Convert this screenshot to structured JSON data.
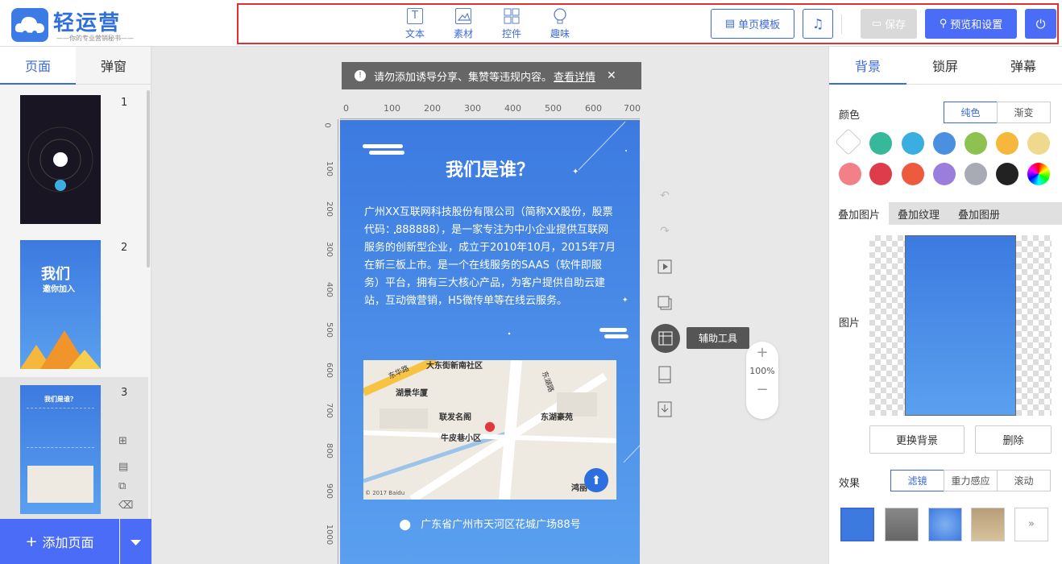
{
  "app": {
    "name": "轻运营",
    "tagline": "——你的专业营销秘书——"
  },
  "toolbar": {
    "tools": [
      "文本",
      "素材",
      "控件",
      "趣味"
    ],
    "single_page_template": "单页模板",
    "save": "保存",
    "preview_settings": "预览和设置"
  },
  "left": {
    "tabs": [
      "页面",
      "弹窗"
    ],
    "pages": [
      "1",
      "2",
      "3"
    ],
    "thumb2_title": "我们",
    "thumb2_sub": "邀你加入",
    "thumb3_title": "我们是谁？",
    "add_page": "添加页面"
  },
  "canvas": {
    "notice": "请勿添加诱导分享、集赞等违规内容。",
    "notice_link": "查看详情",
    "ruler_top": [
      "0",
      "100",
      "200",
      "300",
      "400",
      "500",
      "600",
      "700"
    ],
    "ruler_left": [
      "0",
      "100",
      "200",
      "300",
      "400",
      "500",
      "600",
      "700",
      "800",
      "900",
      "1000"
    ],
    "heading": "我们是谁？",
    "body": "广州XX互联网科技股份有限公司（简称XX股份，股票代码：888888），是一家专注为中小企业提供互联网服务的创新型企业，成立于2010年10月，2015年7月在新三板上市。是一个在线服务的SAAS（软件即服务）平台，拥有三大核心产品，为客户提供自助云建站，互动微营销，H5微传单等在线云服务。",
    "address": "广东省广州市天河区花城广场88号",
    "map_labels": [
      "大东街新南社区",
      "东华路",
      "湖景华厦",
      "联发名阁",
      "东湖豪苑",
      "牛皮巷小区",
      "东湖路",
      "鸿丽",
      "© 2017 Baidu"
    ]
  },
  "side_tools": {
    "assist_tip": "辅助工具",
    "zoom": "100%"
  },
  "right": {
    "tabs": [
      "背景",
      "锁屏",
      "弹幕"
    ],
    "color_label": "颜色",
    "color_modes": [
      "纯色",
      "渐变"
    ],
    "swatches": [
      "#ffffff",
      "#36b89a",
      "#3aaee0",
      "#4a8fe0",
      "#8dc251",
      "#f6b83c",
      "#f0d98c",
      "#f28088",
      "#de3c4b",
      "#ee5a3e",
      "#9b7ddb",
      "#a8abb3",
      "#222222",
      "rainbow"
    ],
    "overlay_tabs": [
      "叠加图片",
      "叠加纹理",
      "叠加图册"
    ],
    "image_label": "图片",
    "replace_bg": "更换背景",
    "delete": "删除",
    "effect_label": "效果",
    "effect_modes": [
      "滤镜",
      "重力感应",
      "滚动"
    ]
  }
}
